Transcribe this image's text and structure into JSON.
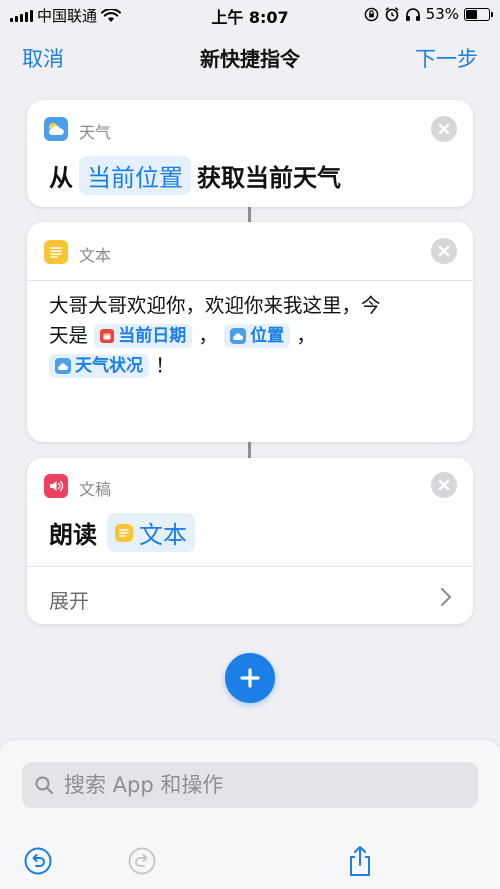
{
  "status_bar": {
    "carrier": "中国联通",
    "time": "上午 8:07",
    "battery_percent": "53%",
    "battery_level": 0.53
  },
  "nav": {
    "cancel": "取消",
    "title": "新快捷指令",
    "next": "下一步"
  },
  "actions": [
    {
      "app_name": "天气",
      "before": "从",
      "token": "当前位置",
      "after": "获取当前天气"
    },
    {
      "app_name": "文本",
      "text_line1": "大哥大哥欢迎你，欢迎你来我这里，今",
      "text_prefix": "天是",
      "token_date": "当前日期",
      "sep1": "，",
      "token_location": "位置",
      "sep2": "，",
      "token_weather": "天气状况",
      "ending": "！"
    },
    {
      "app_name": "文稿",
      "before": "朗读",
      "token": "文本",
      "expand": "展开"
    }
  ],
  "search": {
    "placeholder": "搜索 App 和操作"
  },
  "colors": {
    "accent": "#1a7fe6",
    "background": "#efeff4",
    "weather_icon": "#4a9fe8",
    "text_icon": "#f5c534",
    "speak_icon": "#ee4060",
    "date_icon": "#e8453c"
  },
  "icons": {
    "undo": "undo-icon",
    "redo": "redo-icon",
    "share": "share-icon",
    "search": "search-icon",
    "add": "plus-icon",
    "close": "close-icon",
    "expand": "chevron-right-icon"
  }
}
